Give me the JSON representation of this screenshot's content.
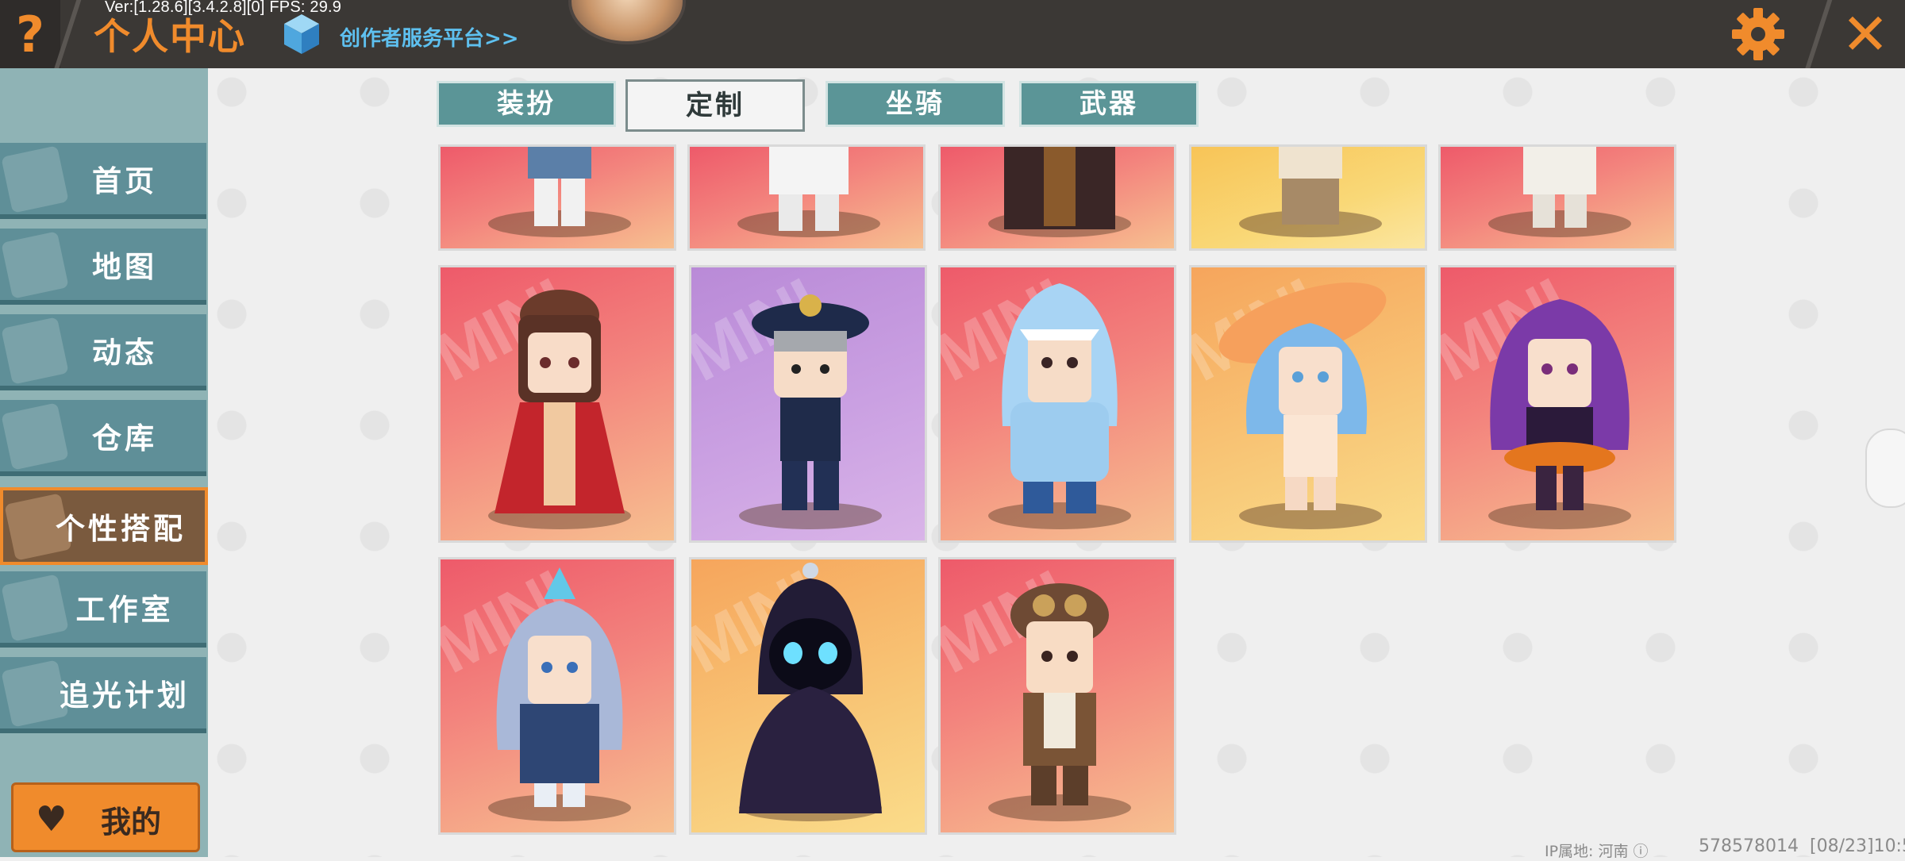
{
  "topbar": {
    "help_glyph": "?",
    "version": "Ver:[1.28.6][3.4.2.8][0] FPS: 29.9",
    "title": "个人中心",
    "creator_link": "创作者服务平台>>",
    "close_glyph": "✕"
  },
  "sidebar": {
    "items": [
      {
        "label": "首页",
        "icon": "house-icon",
        "active": false
      },
      {
        "label": "地图",
        "icon": "map-icon",
        "active": false
      },
      {
        "label": "动态",
        "icon": "bell-icon",
        "active": false
      },
      {
        "label": "仓库",
        "icon": "warehouse-icon",
        "active": false
      },
      {
        "label": "个性搭配",
        "icon": "avatar-style-icon",
        "active": true
      },
      {
        "label": "工作室",
        "icon": "studio-icon",
        "active": false
      },
      {
        "label": "追光计划",
        "icon": "spotlight-icon",
        "active": false
      }
    ],
    "mine_label": "我的",
    "mine_icon": "♥"
  },
  "tabs": [
    {
      "label": "装扮",
      "active": false
    },
    {
      "label": "定制",
      "active": true
    },
    {
      "label": "坐骑",
      "active": false
    },
    {
      "label": "武器",
      "active": false
    }
  ],
  "cards": {
    "watermark": "MINI",
    "row_partial": [
      {
        "bg": "red",
        "character": "skirt-girl"
      },
      {
        "bg": "red",
        "character": "white-suit"
      },
      {
        "bg": "red",
        "character": "dark-robe"
      },
      {
        "bg": "yellow",
        "character": "khaki-outfit"
      },
      {
        "bg": "red",
        "character": "white-coat"
      }
    ],
    "row2": [
      {
        "bg": "red",
        "character": "red-hanfu-lady"
      },
      {
        "bg": "purple",
        "character": "police-officer"
      },
      {
        "bg": "red",
        "character": "shark-hoodie"
      },
      {
        "bg": "orange",
        "character": "blue-hair-sunhat"
      },
      {
        "bg": "red",
        "character": "purple-hair-witch"
      }
    ],
    "row3": [
      {
        "bg": "red",
        "character": "blue-dragon-knight"
      },
      {
        "bg": "orange",
        "character": "dark-hooded-spirit"
      },
      {
        "bg": "red",
        "character": "steampunk-aviator"
      }
    ]
  },
  "footer": {
    "ip_location": "IP属地: 河南 ⓘ",
    "uid": "578578014",
    "time": "[08/23]10:5"
  },
  "colors": {
    "accent": "#f08b2c",
    "topbar": "#3b3835",
    "sidebar_item": "#5f8f98",
    "tab": "#5b9597",
    "link": "#5ec0ef"
  }
}
